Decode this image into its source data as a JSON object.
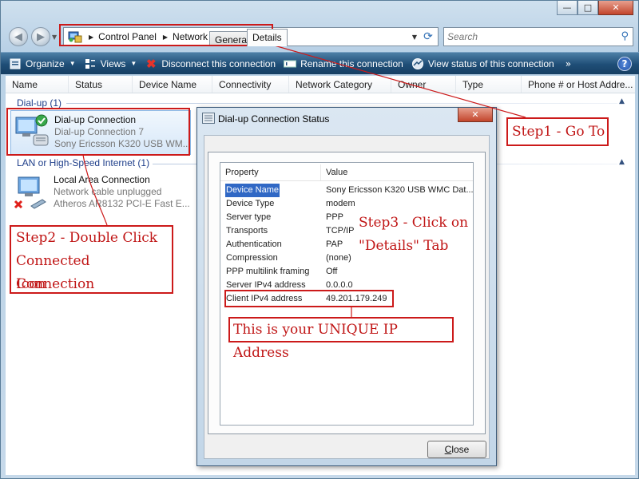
{
  "window": {
    "controls": {
      "minimize": "—",
      "maximize": "□",
      "close": "✕"
    }
  },
  "address_bar": {
    "breadcrumbs": [
      "Control Panel",
      "Network Connections"
    ],
    "search_placeholder": "Search"
  },
  "toolbar": {
    "items": [
      {
        "label": "Organize",
        "icon": "organize-icon",
        "has_menu": true
      },
      {
        "label": "Views",
        "icon": "views-icon",
        "has_menu": true
      },
      {
        "label": "Disconnect this connection",
        "icon": "disconnect-icon"
      },
      {
        "label": "Rename this connection",
        "icon": "rename-icon"
      },
      {
        "label": "View status of this connection",
        "icon": "status-icon"
      }
    ],
    "more": "»",
    "help": "?"
  },
  "columns": [
    "Name",
    "Status",
    "Device Name",
    "Connectivity",
    "Network Category",
    "Owner",
    "Type",
    "Phone # or Host Addre..."
  ],
  "groups": [
    {
      "title": "Dial-up (1)",
      "connections": [
        {
          "name": "Dial-up Connection",
          "status": "Dial-up Connection  7",
          "device": "Sony Ericsson K320 USB WM...",
          "selected": true
        }
      ]
    },
    {
      "title": "LAN or High-Speed Internet (1)",
      "connections": [
        {
          "name": "Local Area Connection",
          "status": "Network cable unplugged",
          "device": "Atheros AR8132 PCI-E Fast E...",
          "selected": false
        }
      ]
    }
  ],
  "dialog": {
    "title": "Dial-up Connection Status",
    "close": "✕",
    "tabs": [
      "General",
      "Details"
    ],
    "active_tab": "Details",
    "table_headers": [
      "Property",
      "Value"
    ],
    "rows": [
      {
        "property": "Device Name",
        "value": "Sony Ericsson K320 USB WMC Dat..."
      },
      {
        "property": "Device Type",
        "value": "modem"
      },
      {
        "property": "Server type",
        "value": "PPP"
      },
      {
        "property": "Transports",
        "value": "TCP/IP"
      },
      {
        "property": "Authentication",
        "value": "PAP"
      },
      {
        "property": "Compression",
        "value": "(none)"
      },
      {
        "property": "PPP multilink framing",
        "value": "Off"
      },
      {
        "property": "Server IPv4 address",
        "value": "0.0.0.0"
      },
      {
        "property": "Client IPv4 address",
        "value": "49.201.179.249"
      }
    ],
    "close_button": {
      "accesskey": "C",
      "rest": "lose"
    }
  },
  "annotations": {
    "step1": "Step1 - Go To",
    "step2_lines": [
      "Step2 - Double Click",
      "Connected Connection",
      "Icon"
    ],
    "step3_lines": [
      "Step3 - Click on",
      "\"Details\" Tab"
    ],
    "unique_ip": "This is your UNIQUE IP Address",
    "color": "#c01515"
  }
}
